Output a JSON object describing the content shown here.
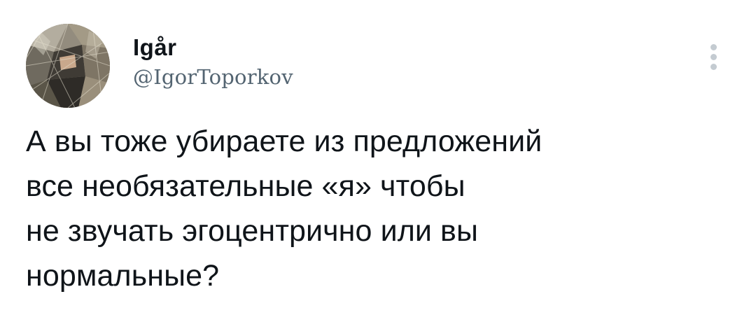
{
  "tweet": {
    "author": {
      "display_name": "Igår",
      "handle": "@IgorToporkov"
    },
    "text": "А вы тоже убираете из предложений\nвсе необязательные «я» чтобы\nне звучать эгоцентрично или вы\nнормальные?"
  },
  "icons": {
    "more": "more-vertical-icon",
    "avatar": "avatar-photo"
  },
  "colors": {
    "text": "#0f1419",
    "secondary": "#536471",
    "more_dots": "#c4cbd1"
  }
}
